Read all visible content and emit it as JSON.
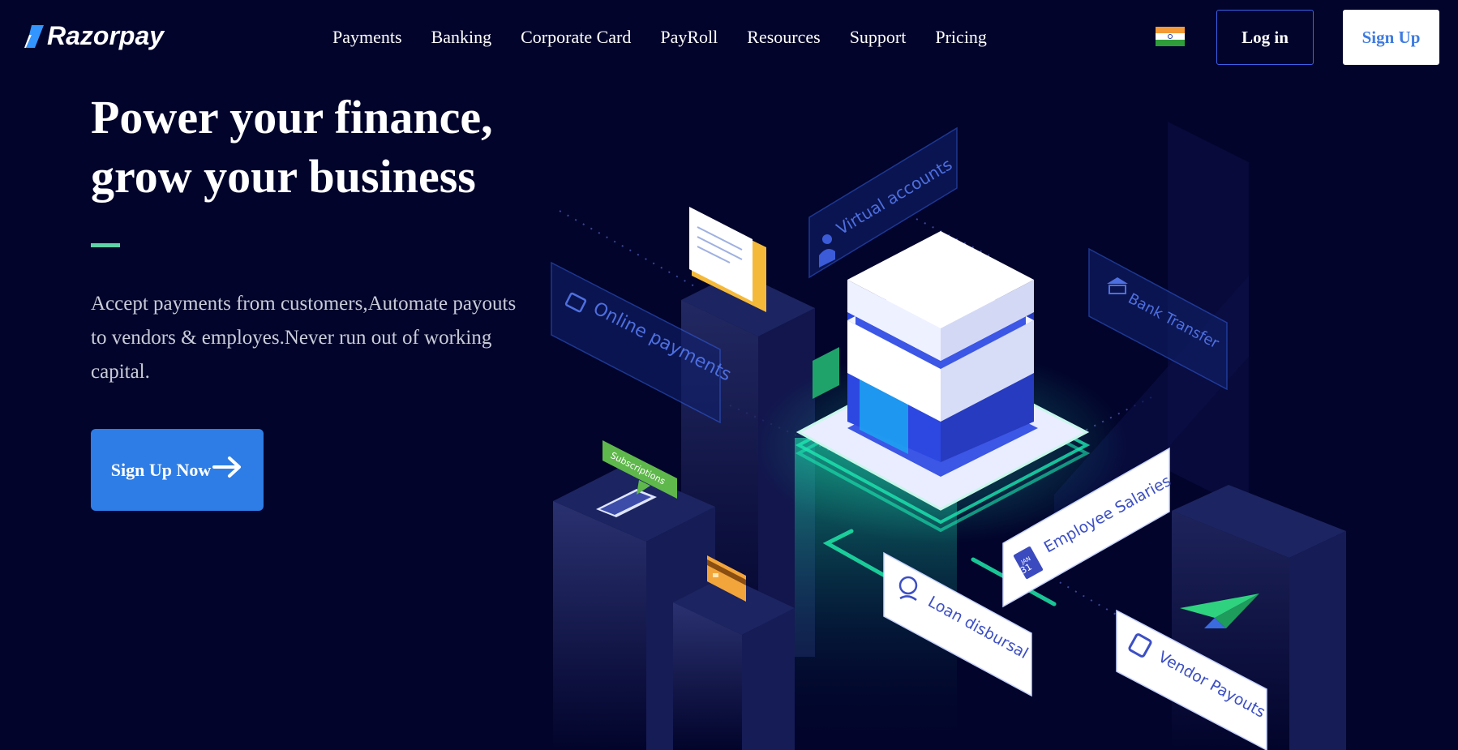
{
  "header": {
    "logo_text": "Razorpay",
    "nav": [
      {
        "label": "Payments"
      },
      {
        "label": "Banking"
      },
      {
        "label": "Corporate Card"
      },
      {
        "label": "PayRoll"
      },
      {
        "label": "Resources"
      },
      {
        "label": "Support"
      },
      {
        "label": "Pricing"
      }
    ],
    "flag_icon": "india-flag-icon",
    "login_label": "Log in",
    "signup_label": "Sign Up"
  },
  "hero": {
    "title_line1": "Power your finance,",
    "title_line2": "grow your business",
    "subtitle": "Accept payments from customers,Automate payouts to vendors & employes.Never run out of working capital.",
    "cta_label": "Sign Up Now",
    "cta_icon": "arrow-right-icon"
  },
  "illustration": {
    "labels": {
      "virtual_accounts": "Virtual accounts",
      "online_payments": "Online payments",
      "bank_transfer": "Bank Transfer",
      "subscriptions": "Subscriptions",
      "employee_salaries": "Employee Salaries",
      "loan_disbursal": "Loan disbursal",
      "vendor_payouts": "Vendor Payouts",
      "calendar_month": "JAN",
      "calendar_day": "31"
    }
  },
  "colors": {
    "background": "#02042b",
    "accent_blue": "#2e7de6",
    "accent_green": "#5ed3a8",
    "signup_text": "#3e7be0",
    "login_border": "#3a62e8"
  }
}
